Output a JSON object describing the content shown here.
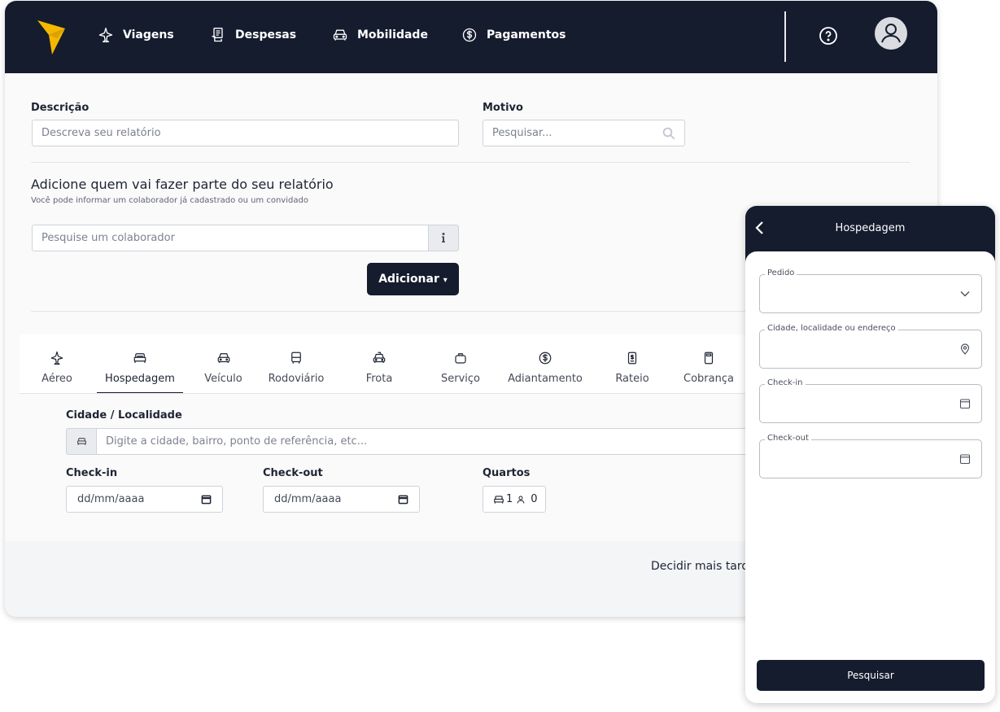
{
  "nav": {
    "items": [
      {
        "label": "Viagens",
        "icon": "plane-icon"
      },
      {
        "label": "Despesas",
        "icon": "receipt-icon"
      },
      {
        "label": "Mobilidade",
        "icon": "car-icon"
      },
      {
        "label": "Pagamentos",
        "icon": "dollar-icon"
      }
    ]
  },
  "form": {
    "descricao_label": "Descrição",
    "descricao_placeholder": "Descreva seu relatório",
    "motivo_label": "Motivo",
    "motivo_placeholder": "Pesquisar...",
    "participants_title": "Adicione quem vai fazer parte do seu relatório",
    "participants_subtitle": "Você pode informar um colaborador já cadastrado ou um convidado",
    "colaborador_placeholder": "Pesquise um colaborador",
    "add_button": "Adicionar",
    "add_caret": "▾"
  },
  "tabs": [
    {
      "label": "Aéreo",
      "icon": "plane-icon",
      "active": false
    },
    {
      "label": "Hospedagem",
      "icon": "bed-icon",
      "active": true
    },
    {
      "label": "Veículo",
      "icon": "car-icon",
      "active": false
    },
    {
      "label": "Rodoviário",
      "icon": "bus-icon",
      "active": false
    },
    {
      "label": "Frota",
      "icon": "taxi-icon",
      "active": false
    },
    {
      "label": "Serviço",
      "icon": "briefcase-icon",
      "active": false
    },
    {
      "label": "Adiantamento",
      "icon": "dollar-icon",
      "active": false
    },
    {
      "label": "Rateio",
      "icon": "split-doc-icon",
      "active": false
    },
    {
      "label": "Cobrança",
      "icon": "calculator-icon",
      "active": false
    }
  ],
  "hotel": {
    "cidade_label": "Cidade / Localidade",
    "cidade_placeholder": "Digite a cidade, bairro, ponto de referência, etc...",
    "checkin_label": "Check-in",
    "checkin_value": "dd/mm/aaaa",
    "checkout_label": "Check-out",
    "checkout_value": "dd/mm/aaaa",
    "quartos_label": "Quartos",
    "rooms": "1",
    "guests": "0"
  },
  "footer": {
    "decidir": "Decidir mais tarde"
  },
  "mobile": {
    "title": "Hospedagem",
    "fields": [
      {
        "label": "Pedido",
        "icon": "chevron-down-icon"
      },
      {
        "label": "Cidade, localidade ou endereço",
        "icon": "location-pin-icon"
      },
      {
        "label": "Check-in",
        "icon": "calendar-icon"
      },
      {
        "label": "Check-out",
        "icon": "calendar-icon"
      }
    ],
    "search_button": "Pesquisar"
  },
  "colors": {
    "navy": "#151c2e",
    "logo_yellow": "#f5b800"
  }
}
